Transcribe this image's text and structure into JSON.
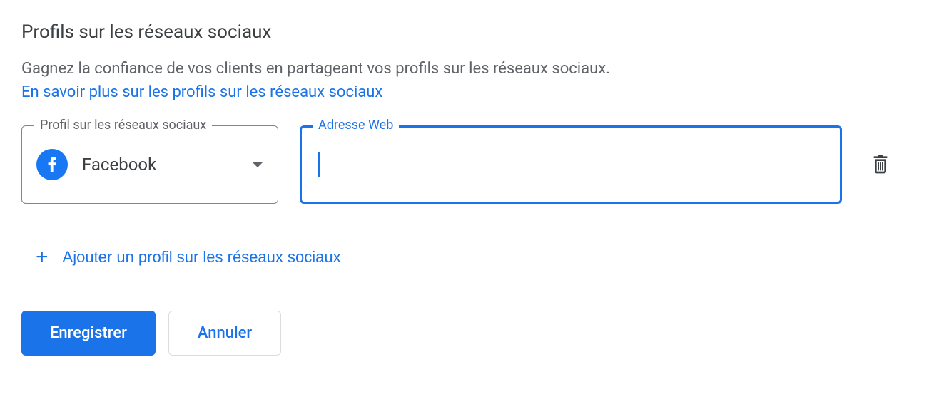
{
  "title": "Profils sur les réseaux sociaux",
  "description": "Gagnez la confiance de vos clients en partageant vos profils sur les réseaux sociaux.",
  "learn_more_link": "En savoir plus sur les profils sur les réseaux sociaux",
  "profile": {
    "select_label": "Profil sur les réseaux sociaux",
    "select_value": "Facebook",
    "url_label": "Adresse Web",
    "url_value": ""
  },
  "add_profile_label": "Ajouter un profil sur les réseaux sociaux",
  "buttons": {
    "save": "Enregistrer",
    "cancel": "Annuler"
  }
}
